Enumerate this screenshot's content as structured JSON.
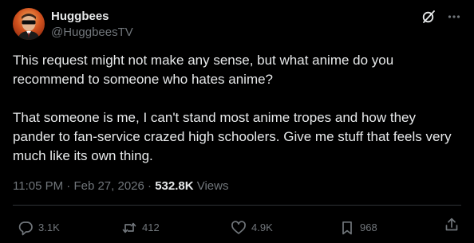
{
  "author": {
    "display_name": "Huggbees",
    "handle": "@HuggbeesTV"
  },
  "header_icons": [
    "grok-icon",
    "more-icon"
  ],
  "post": {
    "paragraphs": [
      "This request might not make any sense, but what anime do you recommend to someone who hates anime?",
      "That someone is me, I can't stand most anime tropes and how they pander to fan-service crazed high schoolers. Give me stuff that feels very much like its own thing."
    ]
  },
  "meta": {
    "time": "11:05 PM",
    "separator": "·",
    "date": "Feb 27, 2026",
    "views_count": "532.8K",
    "views_label": "Views"
  },
  "actions": {
    "replies": "3.1K",
    "reposts": "412",
    "likes": "4.9K",
    "bookmarks": "968"
  },
  "colors": {
    "background": "#000000",
    "text": "#e7e9ea",
    "muted": "#71767b",
    "divider": "#2f3336"
  }
}
